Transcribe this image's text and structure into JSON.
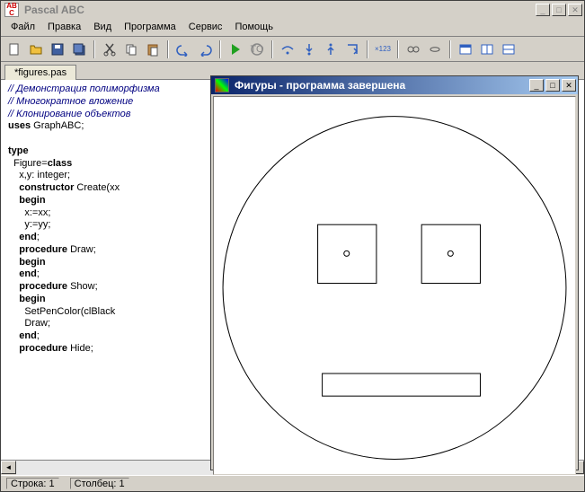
{
  "main_title": "Pascal ABC",
  "menus": [
    "Файл",
    "Правка",
    "Вид",
    "Программа",
    "Сервис",
    "Помощь"
  ],
  "tab_name": "*figures.pas",
  "code_lines": [
    {
      "cls": "cm",
      "text": "// Демонстрация полиморфизма"
    },
    {
      "cls": "cm",
      "text": "// Многократное вложение"
    },
    {
      "cls": "cm",
      "text": "// Клонирование объектов"
    },
    {
      "cls": "",
      "text": "<kw>uses</kw> GraphABC;"
    },
    {
      "cls": "",
      "text": ""
    },
    {
      "cls": "",
      "text": "<kw>type</kw>"
    },
    {
      "cls": "",
      "text": "  Figure=<kw>class</kw>"
    },
    {
      "cls": "",
      "text": "    x,y: integer;"
    },
    {
      "cls": "",
      "text": "    <kw>constructor</kw> Create(xx"
    },
    {
      "cls": "",
      "text": "    <kw>begin</kw>"
    },
    {
      "cls": "",
      "text": "      x:=xx;"
    },
    {
      "cls": "",
      "text": "      y:=yy;"
    },
    {
      "cls": "",
      "text": "    <kw>end</kw>;"
    },
    {
      "cls": "",
      "text": "    <kw>procedure</kw> Draw;"
    },
    {
      "cls": "",
      "text": "    <kw>begin</kw>"
    },
    {
      "cls": "",
      "text": "    <kw>end</kw>;"
    },
    {
      "cls": "",
      "text": "    <kw>procedure</kw> Show;"
    },
    {
      "cls": "",
      "text": "    <kw>begin</kw>"
    },
    {
      "cls": "",
      "text": "      SetPenColor(clBlack"
    },
    {
      "cls": "",
      "text": "      Draw;"
    },
    {
      "cls": "",
      "text": "    <kw>end</kw>;"
    },
    {
      "cls": "",
      "text": "    <kw>procedure</kw> Hide;"
    }
  ],
  "status": {
    "line": "Строка: 1",
    "col": "Столбец: 1"
  },
  "output_title": "Фигуры - программа завершена",
  "toolbar_icons": [
    "new",
    "open",
    "save",
    "saveall",
    "sep",
    "cut",
    "copy",
    "paste",
    "sep",
    "undo",
    "redo",
    "sep",
    "run",
    "stop",
    "sep",
    "step-over",
    "step-into",
    "step-out",
    "run-to",
    "sep",
    "var123",
    "sep",
    "goggles",
    "infinity",
    "sep",
    "win1",
    "win2",
    "win3"
  ]
}
